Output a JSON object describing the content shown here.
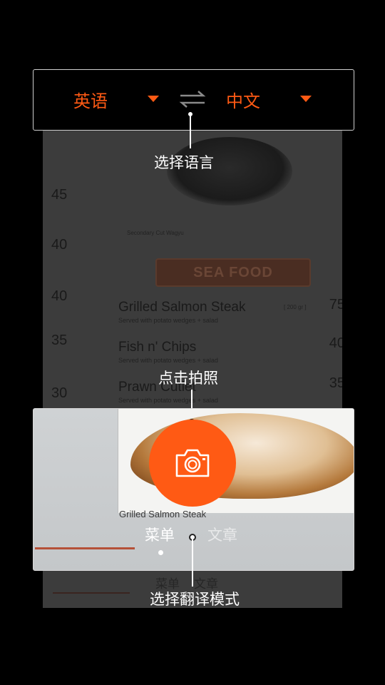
{
  "language_bar": {
    "source_language": "英语",
    "target_language": "中文",
    "icons": {
      "source_dropdown": "caret-down-icon",
      "target_dropdown": "caret-down-icon",
      "swap": "swap-arrows-icon"
    },
    "accent_color": "#ff5a14"
  },
  "hints": {
    "select_language": "选择语言",
    "tap_to_shoot": "点击拍照",
    "select_mode": "选择翻译模式"
  },
  "capture": {
    "shutter_icon": "camera-icon",
    "modes": [
      "菜单",
      "文章"
    ],
    "selected_mode": "菜单"
  },
  "preview_menu": {
    "prices": [
      "45",
      "40",
      "40",
      "35",
      "30"
    ],
    "steak_caption": "Secondary Cut Wagyu",
    "section": "SEA FOOD",
    "dishes": [
      {
        "name": "Grilled Salmon Steak",
        "sub": "Served with potato wedges + salad",
        "price": "75",
        "note": "[ 200 gr ]"
      },
      {
        "name": "Fish n' Chips",
        "sub": "Served with potato wedges + salad",
        "price": "40"
      },
      {
        "name": "Prawn Cutlet",
        "sub": "Served with potato wedges + salad",
        "price": "35"
      }
    ],
    "photo_caption": "Grilled Salmon Steak"
  }
}
